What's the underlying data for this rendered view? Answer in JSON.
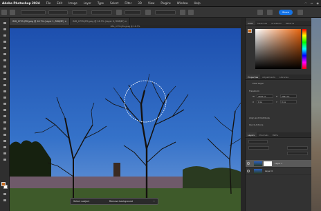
{
  "menubar": {
    "app_name": "Adobe Photoshop 2024",
    "items": [
      "File",
      "Edit",
      "Image",
      "Layer",
      "Type",
      "Select",
      "Filter",
      "3D",
      "View",
      "Plugins",
      "Window",
      "Help"
    ]
  },
  "options": {
    "share_label": "Share"
  },
  "tabs": [
    {
      "label": "IMG_0735.JPG.jpeg @ 16.7% (Layer 1, RGB/8*) ×",
      "active": true
    },
    {
      "label": "IMG_0735.JPG.jpeg @ 16.7% (Layer 0, RGB/8*) ×",
      "active": false
    }
  ],
  "canvas": {
    "title": "IMG_0735.JPG.jpeg @ 16.7%"
  },
  "context_bar": {
    "select_subject": "Select subject",
    "remove_background": "Remove background"
  },
  "panels": {
    "color_tabs": [
      "Color",
      "Swatches",
      "Gradients",
      "Patterns"
    ],
    "properties_tabs": [
      "Properties",
      "Adjustments",
      "Libraries"
    ],
    "properties": {
      "type_label": "Pixel Layer",
      "transform_label": "Transform",
      "w_label": "W",
      "w_value": "4032 px",
      "h_label": "H",
      "h_value": "3024 px",
      "x_label": "X",
      "x_value": "0 px",
      "y_label": "Y",
      "y_value": "0 px",
      "align_label": "Align and Distribute",
      "quick_actions_label": "Quick Actions"
    },
    "layers_tabs": [
      "Layers",
      "Channels",
      "Paths"
    ],
    "layers": [
      {
        "name": "Layer 1",
        "selected": true
      },
      {
        "name": "Layer 0",
        "selected": false
      }
    ]
  },
  "colors": {
    "foreground": "#c86a1c",
    "background": "#ffffff",
    "accent": "#1473e6"
  },
  "status": {
    "zoom": "16.67%"
  }
}
